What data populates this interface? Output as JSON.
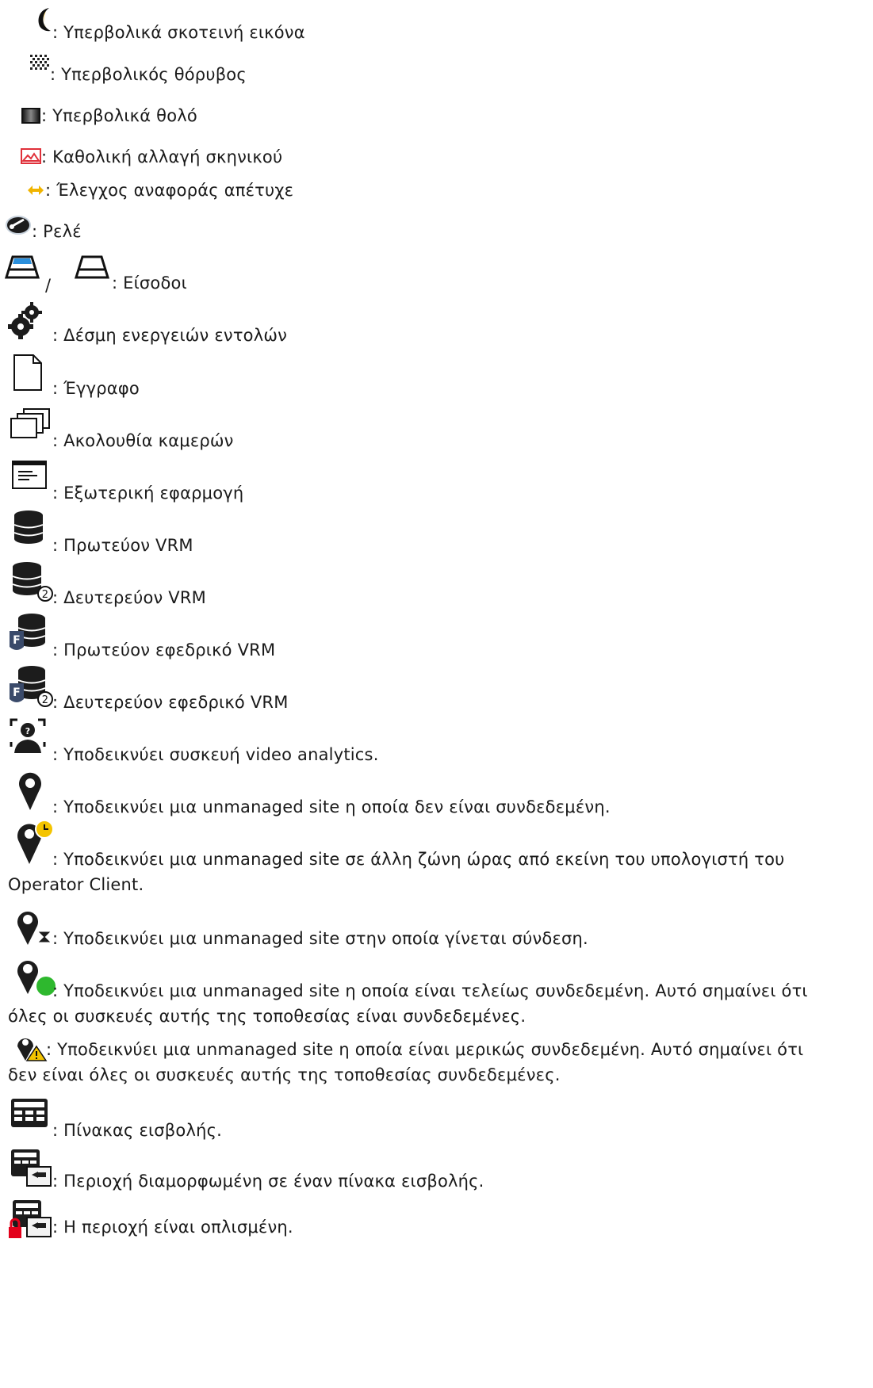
{
  "items": [
    {
      "icon": "moon-icon",
      "text": ": Υπερβολικά σκοτεινή εικόνα"
    },
    {
      "icon": "noise-icon",
      "text": ": Υπερβολικός θόρυβος"
    },
    {
      "icon": "blur-icon",
      "text": ": Υπερβολικά θολό"
    },
    {
      "icon": "scene-change-icon",
      "text": ": Καθολική αλλαγή σκηνικού"
    },
    {
      "icon": "reference-check-icon",
      "text": ": Έλεγχος αναφοράς απέτυχε"
    },
    {
      "icon": "relay-icon",
      "text": ": Ρελέ"
    },
    {
      "icon": "input-icon",
      "text": ": Είσοδοι",
      "separator": "/"
    },
    {
      "icon": "gears-icon",
      "text": ": Δέσμη ενεργειών εντολών"
    },
    {
      "icon": "document-icon",
      "text": ": Έγγραφο"
    },
    {
      "icon": "camera-sequence-icon",
      "text": ": Ακολουθία καμερών"
    },
    {
      "icon": "external-app-icon",
      "text": ": Εξωτερική εφαρμογή"
    },
    {
      "icon": "primary-vrm-icon",
      "text": ": Πρωτεύον VRM"
    },
    {
      "icon": "secondary-vrm-icon",
      "text": ": Δευτερεύον VRM"
    },
    {
      "icon": "failover-primary-vrm-icon",
      "text": ": Πρωτεύον εφεδρικό VRM"
    },
    {
      "icon": "failover-secondary-vrm-icon",
      "text": ": Δευτερεύον εφεδρικό VRM"
    },
    {
      "icon": "video-analytics-icon",
      "text": ": Υποδεικνύει συσκευή video analytics."
    },
    {
      "icon": "site-disconnected-icon",
      "text": ": Υποδεικνύει μια unmanaged site η οποία δεν είναι συνδεδεμένη."
    },
    {
      "icon": "site-timezone-icon",
      "text": ": Υποδεικνύει μια unmanaged site σε άλλη ζώνη ώρας από εκείνη του υπολογιστή του",
      "text2": "Operator Client."
    },
    {
      "icon": "site-connecting-icon",
      "text": ": Υποδεικνύει μια unmanaged site στην οποία γίνεται σύνδεση."
    },
    {
      "icon": "site-connected-icon",
      "text": ": Υποδεικνύει μια unmanaged site η οποία είναι τελείως συνδεδεμένη. Αυτό σημαίνει ότι",
      "text2": "όλες οι συσκευές αυτής της τοποθεσίας είναι συνδεδεμένες."
    },
    {
      "icon": "site-partial-icon",
      "text": ": Υποδεικνύει μια unmanaged site η οποία είναι μερικώς συνδεδεμένη. Αυτό σημαίνει ότι",
      "text2": "δεν είναι όλες οι συσκευές αυτής της τοποθεσίας συνδεδεμένες."
    },
    {
      "icon": "intrusion-panel-icon",
      "text": ": Πίνακας εισβολής."
    },
    {
      "icon": "intrusion-area-icon",
      "text": ": Περιοχή διαμορφωμένη σε έναν πίνακα εισβολής."
    },
    {
      "icon": "area-armed-icon",
      "text": ": Η περιοχή είναι οπλισμένη."
    }
  ]
}
